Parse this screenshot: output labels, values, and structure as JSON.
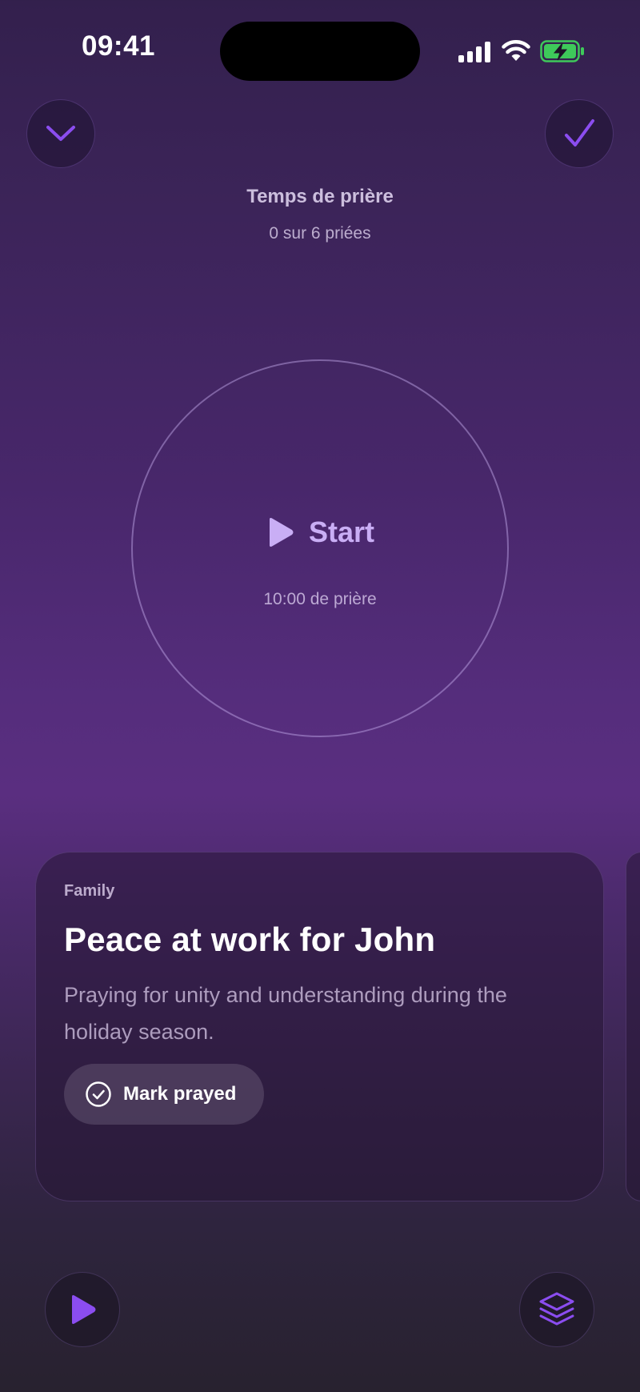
{
  "status_bar": {
    "time": "09:41"
  },
  "header": {
    "collapse_icon": "chevron-down-icon",
    "done_icon": "checkmark-icon",
    "title": "Temps de prière",
    "subtitle": "0 sur 6 priées"
  },
  "timer": {
    "start_label": "Start",
    "duration_label": "10:00 de prière",
    "play_icon": "play-icon"
  },
  "card": {
    "category": "Family",
    "title": "Peace at work for John",
    "description": "Praying for unity and understanding during the holiday season.",
    "mark_button_label": "Mark prayed",
    "mark_icon": "check-circle-icon"
  },
  "bottom_bar": {
    "play_icon": "play-icon",
    "stack_icon": "layers-icon"
  },
  "colors": {
    "accent": "#8b4df0",
    "start_text": "#c9aef5",
    "battery_green": "#3ec95a"
  }
}
